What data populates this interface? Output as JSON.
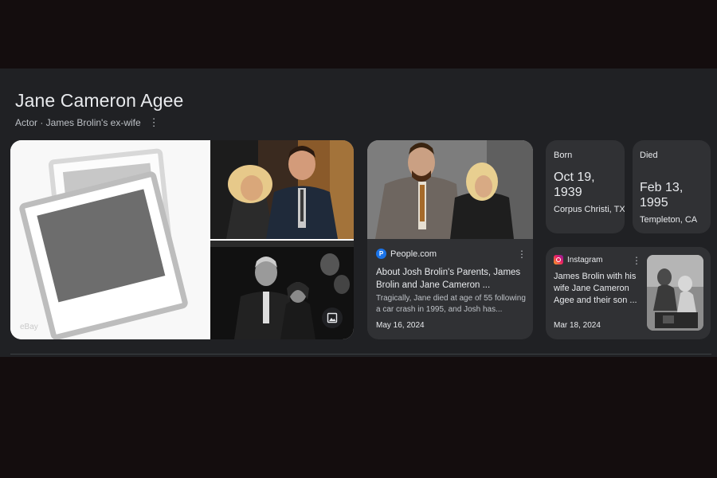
{
  "entity": {
    "title": "Jane Cameron Agee",
    "subtitle": "Actor · James Brolin's ex-wife"
  },
  "images": {
    "source_label": "eBay"
  },
  "article": {
    "source": "People.com",
    "source_initial": "P",
    "title": "About Josh Brolin's Parents, James Brolin and Jane Cameron ...",
    "snippet": "Tragically, Jane died at age of 55 following a car crash in 1995, and Josh has...",
    "date": "May 16, 2024"
  },
  "facts": {
    "born": {
      "label": "Born",
      "date": "Oct 19, 1939",
      "place": "Corpus Christi, TX"
    },
    "died": {
      "label": "Died",
      "date": "Feb 13, 1995",
      "place": "Templeton, CA"
    }
  },
  "social": {
    "source": "Instagram",
    "title": "James Brolin with his wife Jane Cameron Agee and their son ...",
    "date": "Mar 18, 2024"
  },
  "icons": {
    "more": "more-vert-icon",
    "gallery": "image-gallery-icon",
    "placeholder": "photo-placeholder-icon"
  },
  "colors": {
    "page_bg": "#140d0e",
    "panel_bg": "#202124",
    "card_bg": "#303134",
    "text_primary": "#e8eaed",
    "text_secondary": "#bdc1c6"
  }
}
